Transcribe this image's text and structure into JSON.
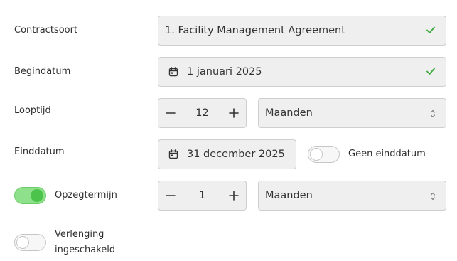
{
  "contract_type": {
    "label": "Contractsoort",
    "value": "1. Facility Management Agreement",
    "valid_icon": "check-icon"
  },
  "start_date": {
    "label": "Begindatum",
    "value": "1 januari 2025",
    "icon": "calendar-icon",
    "valid_icon": "check-icon"
  },
  "duration": {
    "label": "Looptijd",
    "amount": "12",
    "unit": "Maanden"
  },
  "end_date": {
    "label": "Einddatum",
    "value": "31 december 2025",
    "icon": "calendar-icon",
    "no_end_label": "Geen einddatum",
    "no_end_enabled": false
  },
  "notice": {
    "label": "Opzegtermijn",
    "enabled": true,
    "amount": "1",
    "unit": "Maanden"
  },
  "renewal": {
    "label_line1": "Verlenging",
    "label_line2": "ingeschakeld",
    "enabled": false
  },
  "colors": {
    "valid_green": "#3aa83a",
    "toggle_on": "#4cc34a",
    "field_bg": "#efefef"
  }
}
